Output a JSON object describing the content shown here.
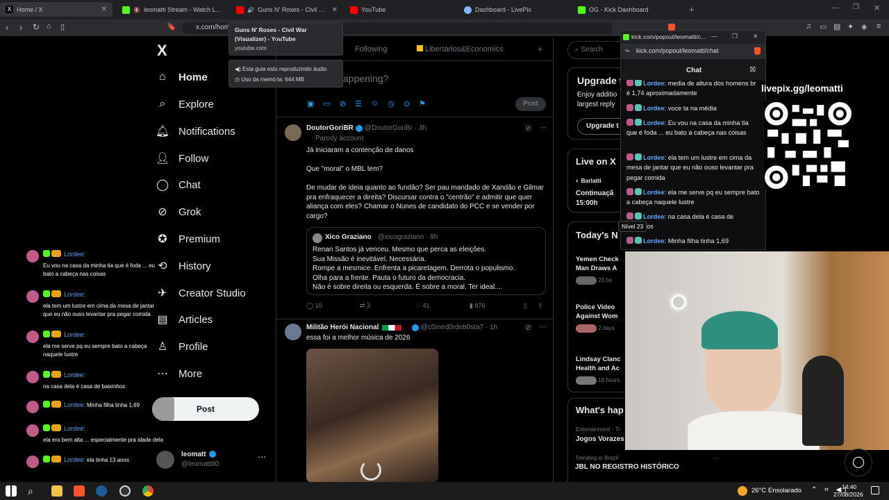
{
  "browser": {
    "tabs": [
      {
        "title": "Home / X",
        "active": true
      },
      {
        "title": "leomatti Stream - Watch Live on"
      },
      {
        "title": "Guns N' Roses - Civil War (Vi"
      },
      {
        "title": "YouTube"
      },
      {
        "title": "Dashboard - LivePix"
      },
      {
        "title": "OG - Kick Dashboard"
      }
    ],
    "url": "x.com/hom",
    "tooltip": {
      "title": "Guns N' Roses - Civil War (Visualizer) - YouTube",
      "domain": "youtube.com",
      "audio": "Esta guia está reproduzindo áudio",
      "memory": "Uso da memória: 644 MB"
    }
  },
  "x": {
    "logo": "X",
    "nav": [
      {
        "label": "Home",
        "icon": "home-icon"
      },
      {
        "label": "Explore",
        "icon": "search-icon"
      },
      {
        "label": "Notifications",
        "icon": "bell-icon"
      },
      {
        "label": "Follow",
        "icon": "follow-icon"
      },
      {
        "label": "Chat",
        "icon": "chat-icon"
      },
      {
        "label": "Grok",
        "icon": "grok-icon"
      },
      {
        "label": "Premium",
        "icon": "premium-icon"
      },
      {
        "label": "History",
        "icon": "history-icon"
      },
      {
        "label": "Creator Studio",
        "icon": "creator-icon"
      },
      {
        "label": "Articles",
        "icon": "articles-icon"
      },
      {
        "label": "Profile",
        "icon": "profile-icon"
      },
      {
        "label": "More",
        "icon": "more-icon"
      }
    ],
    "post_button": "Post",
    "profile": {
      "name": "leomatt",
      "handle": "@leomatt80"
    },
    "feed_tabs": [
      "Following",
      "Libertários&Economics"
    ],
    "compose_placeholder": "appening?",
    "compose_post": "Post",
    "posts": [
      {
        "name": "DoutorGoriBR",
        "handle": "@DoutorGoriBr · 3h",
        "sub": "Parody account",
        "lines": [
          "Já iniciaram a contenção de danos",
          "Que \"moral\" o MBL tem?",
          "De mudar de ideia quanto ao fundão? Ser pau mandado de Xandão e Gilmar pra enfraquecer a direita? Discursar contra o \"centrão\" e admitir que quer aliança com eles? Chamar o Nunes de candidato do PCC e se vender por cargo?"
        ],
        "quote": {
          "name": "Xico Graziano",
          "handle": "@xicograziano · 8h",
          "lines": [
            "Renan Santos já venceu. Mesmo que perca as eleições.",
            "Sua Missão é inevitável. Necessária.",
            "Rompe a mesmice. Enfrenta a picaretagem. Derrota o populismo.",
            "Olha para a frente. Pauta o futuro da democracia.",
            "Não é sobre direita ou esquerda. É sobre a moral. Ter ideal...."
          ]
        },
        "stats": {
          "replies": "10",
          "reposts": "3",
          "likes": "41",
          "views": "876"
        }
      },
      {
        "name": "Militão Herói Nacional",
        "handle": "@c0med0rdeb0sta7 · 1h",
        "lines": [
          "essa foi a melhor música de 2026"
        ]
      }
    ],
    "right": {
      "search": "Search",
      "upgrade_title": "Upgrade t",
      "upgrade_text_1": "Enjoy additio",
      "upgrade_text_2": "largest reply",
      "upgrade_btn": "Upgrade t",
      "live_title": "Live on X",
      "live_user": "Barlatti",
      "live_text_1": "Continuaçã",
      "live_text_2": "15:00h",
      "news_title": "Today's N",
      "news": [
        {
          "l1": "Yemen Check",
          "l2": "Man Draws A",
          "meta": "23 ho"
        },
        {
          "l1": "Police Video",
          "l2": "Against Wom",
          "meta": "2 days"
        },
        {
          "l1": "Lindsay Clanc",
          "l2": "Health and Ac",
          "meta": "18 hours"
        }
      ],
      "whats_title": "What's hap",
      "trend1_cat": "Entertainment · Tr",
      "trend1": "Jogos Vorazes",
      "trend2_cat": "Trending in Brazil",
      "trend2": "JBL NO REGISTRO HISTÓRICO"
    }
  },
  "chat": {
    "window_title": "kick.com/popout/leomatti/c...",
    "url": "kick.com/popout/leomatti/chat",
    "header": "Chat",
    "messages": [
      {
        "user": "Lordee",
        "text": "media de altura dos homens br é 1,74 aproximadamente"
      },
      {
        "user": "Lordee",
        "text": "voce ta na média"
      },
      {
        "user": "Lordee",
        "text": "Eu vou na casa da minha tia que é foda ... eu bato a cabeça nas coisas"
      },
      {
        "user": "Lordee",
        "text": "ela tem um lustre em cima da mesa de jantar que eu não ouso levantar pra pegar comida"
      },
      {
        "user": "Lordee",
        "text": "ela me serve pq eu sempre bato a cabeça naquele lustre"
      },
      {
        "user": "Lordee",
        "text": "na casa dela é casa de baixinhos"
      },
      {
        "user": "Lordee",
        "text": "Minha filha tinha 1,69"
      }
    ],
    "level_tooltip": "Nível 23"
  },
  "overlay_chat": [
    {
      "user": "Lordee:",
      "text": "Eu vou na casa da minha tia que é foda ... eu bato a cabeça nas coisas"
    },
    {
      "user": "Lordee:",
      "text": "ela tem um lustre em cima da mesa de jantar que eu não ouso levantar pra pegar comida"
    },
    {
      "user": "Lordee:",
      "text": "ela me serve pq eu sempre bato a cabeça naquele lustre"
    },
    {
      "user": "Lordee:",
      "text": "na casa dela é casa de baixinhos"
    },
    {
      "user": "Lordee:",
      "text": "Minha filha tinha 1,69"
    },
    {
      "user": "Lordee:",
      "text": "ela era bem alta ... especialmente pra idade dela"
    },
    {
      "user": "Lordee:",
      "text": "ela tinha 13 anos"
    }
  ],
  "livepix": {
    "label": "livepix.gg/leomatti"
  },
  "taskbar": {
    "weather": "26°C  Ensolarado",
    "time": "14:40",
    "date": "27/08/2026"
  },
  "colors": {
    "accent": "#1d9bf0",
    "kick_green": "#53fc18",
    "lordee": "#5fa8ff"
  }
}
